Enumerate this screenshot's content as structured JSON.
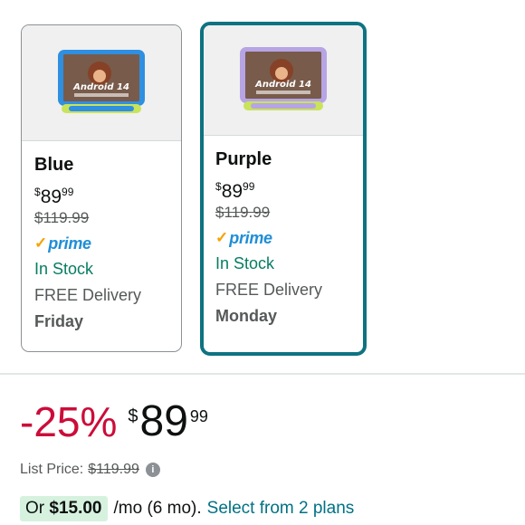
{
  "variants": [
    {
      "color": "Blue",
      "price_symbol": "$",
      "price_whole": "89",
      "price_cents": "99",
      "list_price": "$119.99",
      "prime_label": "prime",
      "stock": "In Stock",
      "delivery": "FREE Delivery",
      "delivery_day": "Friday",
      "device_color": "#2f8fe0",
      "stand_color": "#c9e35a",
      "image_text": "Android 14"
    },
    {
      "color": "Purple",
      "price_symbol": "$",
      "price_whole": "89",
      "price_cents": "99",
      "list_price": "$119.99",
      "prime_label": "prime",
      "stock": "In Stock",
      "delivery": "FREE Delivery",
      "delivery_day": "Monday",
      "device_color": "#b7a4e4",
      "stand_color": "#c9e35a",
      "image_text": "Android 14"
    }
  ],
  "buybox": {
    "discount": "-25%",
    "price_symbol": "$",
    "price_whole": "89",
    "price_cents": "99",
    "list_price_label": "List Price:",
    "list_price": "$119.99",
    "plan_prefix": "Or",
    "plan_amount": "$15.00",
    "plan_term": "/mo (6 mo).",
    "plan_link": "Select from 2 plans"
  },
  "colors": {
    "selected_border": "#0e7381",
    "discount_red": "#cc0c39",
    "stock_green": "#067d62",
    "link_teal": "#007185",
    "plan_badge_bg": "#d6f2df"
  }
}
